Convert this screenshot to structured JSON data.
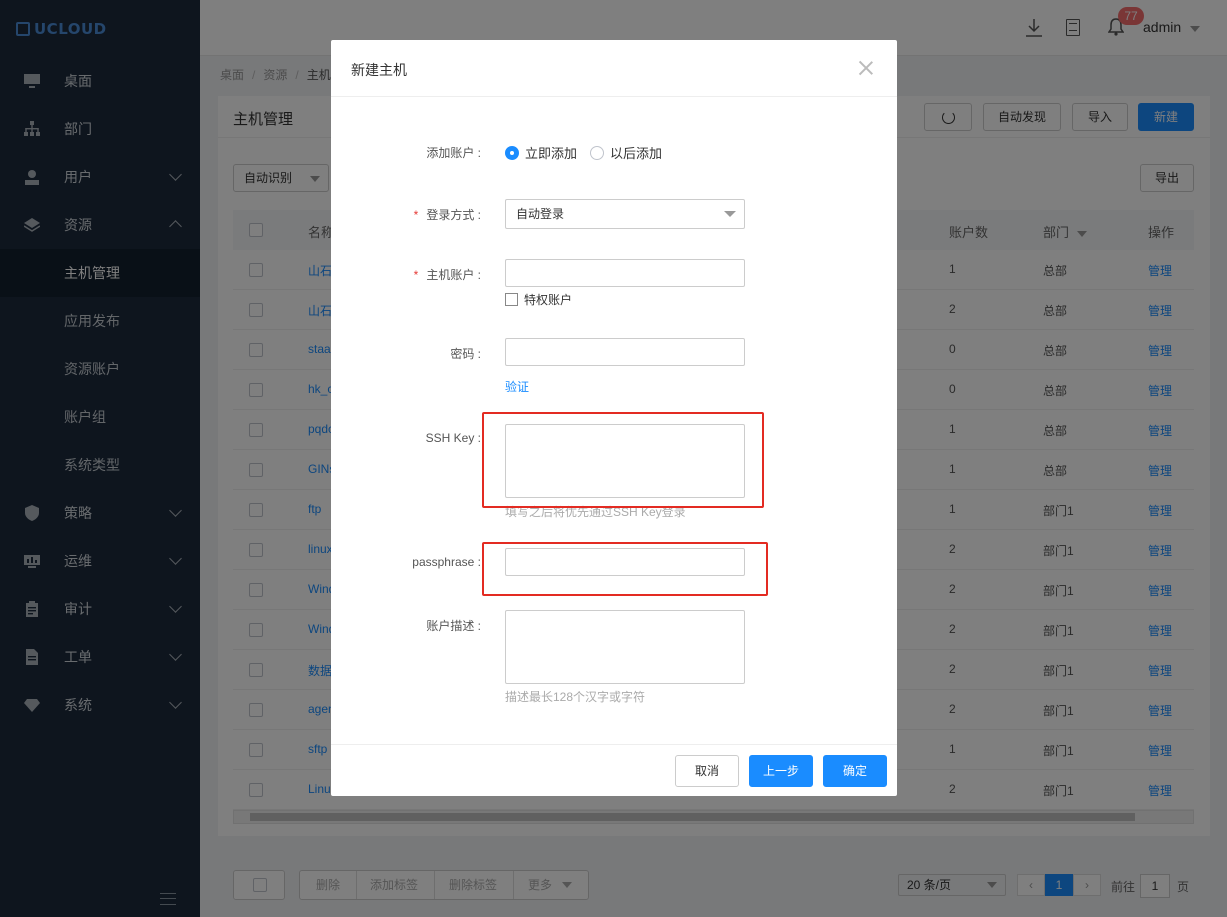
{
  "app": {
    "logo": "UCLOUD"
  },
  "sidebar": {
    "items": [
      {
        "label": "桌面",
        "icon": "monitor-icon"
      },
      {
        "label": "部门",
        "icon": "org-chart-icon"
      },
      {
        "label": "用户",
        "icon": "user-icon",
        "expanded": false
      },
      {
        "label": "资源",
        "icon": "layers-icon",
        "expanded": true
      },
      {
        "label": "策略",
        "icon": "shield-icon",
        "expanded": false
      },
      {
        "label": "运维",
        "icon": "dashboard-icon",
        "expanded": false
      },
      {
        "label": "审计",
        "icon": "clipboard-icon",
        "expanded": false
      },
      {
        "label": "工单",
        "icon": "document-icon",
        "expanded": false
      },
      {
        "label": "系统",
        "icon": "diamond-icon",
        "expanded": false
      }
    ],
    "resource_sub": [
      "主机管理",
      "应用发布",
      "资源账户",
      "账户组",
      "系统类型"
    ],
    "active_sub": "主机管理"
  },
  "topbar": {
    "badge": "77",
    "user": "admin"
  },
  "breadcrumb": [
    "桌面",
    "资源",
    "主机管理"
  ],
  "panel": {
    "title": "主机管理",
    "buttons": {
      "auto_discover": "自动发现",
      "import": "导入",
      "new": "新建",
      "export": "导出"
    },
    "filter_select": "自动识别"
  },
  "table": {
    "headers": {
      "name": "名称",
      "accounts": "账户数",
      "dept": "部门",
      "op": "操作"
    },
    "rows": [
      {
        "name": "山石",
        "accounts": "1",
        "dept": "总部",
        "op": "管理"
      },
      {
        "name": "山石",
        "accounts": "2",
        "dept": "总部",
        "op": "管理"
      },
      {
        "name": "staa",
        "accounts": "0",
        "dept": "总部",
        "op": "管理"
      },
      {
        "name": "hk_c",
        "accounts": "0",
        "dept": "总部",
        "op": "管理"
      },
      {
        "name": "pqdc",
        "accounts": "1",
        "dept": "总部",
        "op": "管理"
      },
      {
        "name": "GINs",
        "accounts": "1",
        "dept": "总部",
        "op": "管理"
      },
      {
        "name": "ftp",
        "accounts": "1",
        "dept": "部门1",
        "op": "管理"
      },
      {
        "name": "linux",
        "accounts": "2",
        "dept": "部门1",
        "op": "管理"
      },
      {
        "name": "Wind",
        "accounts": "2",
        "dept": "部门1",
        "op": "管理"
      },
      {
        "name": "Wind",
        "accounts": "2",
        "dept": "部门1",
        "op": "管理"
      },
      {
        "name": "数据",
        "accounts": "2",
        "dept": "部门1",
        "op": "管理"
      },
      {
        "name": "agen",
        "accounts": "2",
        "dept": "部门1",
        "op": "管理"
      },
      {
        "name": "sftp",
        "accounts": "1",
        "dept": "部门1",
        "op": "管理"
      },
      {
        "name": "Linu",
        "accounts": "2",
        "dept": "部门1",
        "op": "管理"
      }
    ]
  },
  "footer": {
    "bulk": {
      "delete": "删除",
      "add_tag": "添加标签",
      "remove_tag": "删除标签",
      "more": "更多"
    },
    "page_size": "20 条/页",
    "current_page": "1",
    "goto_prefix": "前往",
    "goto_value": "1",
    "goto_suffix": "页"
  },
  "modal": {
    "title": "新建主机",
    "add_account": {
      "label": "添加账户 :",
      "options": [
        "立即添加",
        "以后添加"
      ],
      "selected": "立即添加"
    },
    "login_method": {
      "label": "登录方式 :",
      "value": "自动登录",
      "required": true
    },
    "host_account": {
      "label": "主机账户 :",
      "required": true,
      "value": "",
      "privileged_label": "特权账户"
    },
    "password": {
      "label": "密码 :",
      "value": "",
      "verify_link": "验证"
    },
    "ssh_key": {
      "label": "SSH Key :",
      "value": "",
      "hint": "填写之后将优先通过SSH Key登录"
    },
    "passphrase": {
      "label": "passphrase :",
      "value": ""
    },
    "description": {
      "label": "账户描述 :",
      "value": "",
      "hint": "描述最长128个汉字或字符"
    },
    "buttons": {
      "cancel": "取消",
      "prev": "上一步",
      "ok": "确定"
    }
  },
  "colors": {
    "primary": "#1a8cff",
    "sidebar_bg": "#1c2b3d",
    "highlight_box": "#e32b22"
  }
}
